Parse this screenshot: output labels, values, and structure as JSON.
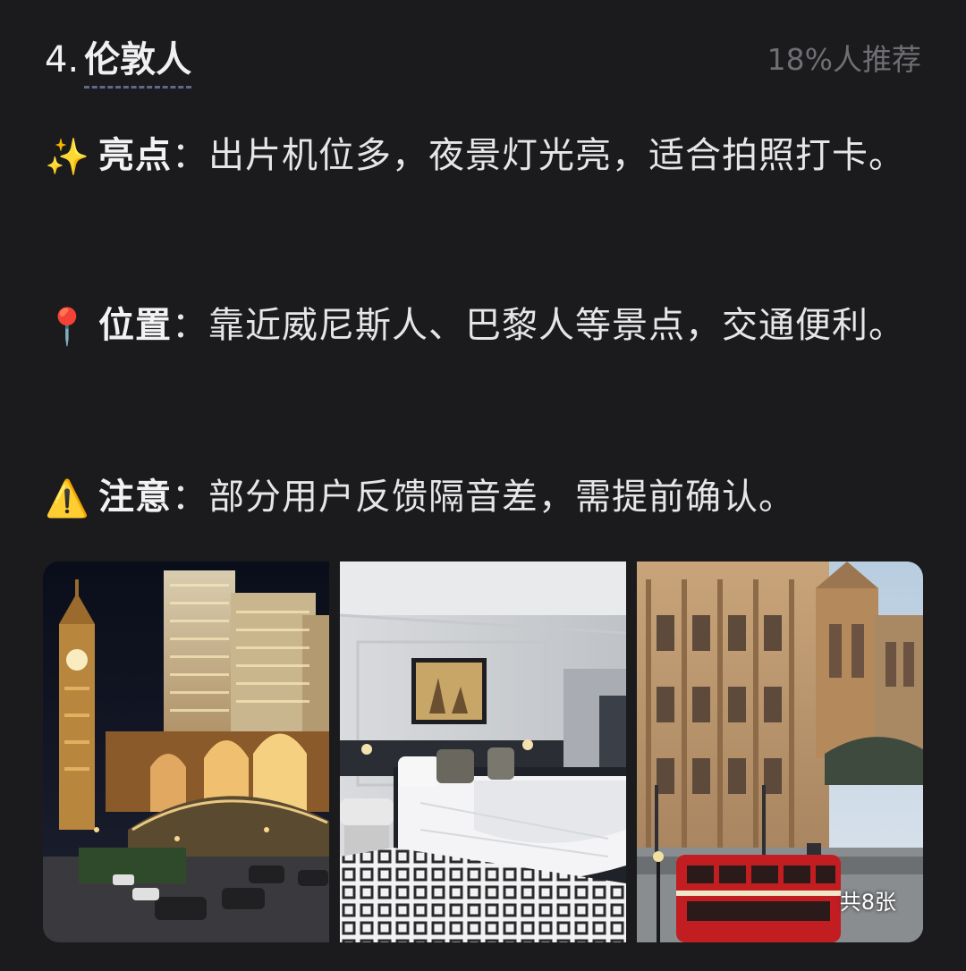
{
  "header": {
    "number": "4.",
    "name": "伦敦人",
    "recommend": "18%人推荐"
  },
  "items": [
    {
      "emoji": "✨",
      "label": "亮点",
      "sep": "：",
      "text": "出片机位多，夜景灯光亮，适合拍照打卡。"
    },
    {
      "emoji": "📍",
      "label": "位置",
      "sep": "：",
      "text": "靠近威尼斯人、巴黎人等景点，交通便利。"
    },
    {
      "emoji": "⚠️",
      "label": "注意",
      "sep": "：",
      "text": "部分用户反馈隔音差，需提前确认。"
    }
  ],
  "gallery": {
    "photos": [
      {
        "icon": "london-night-exterior-photo"
      },
      {
        "icon": "hotel-bedroom-photo"
      },
      {
        "icon": "gothic-facade-red-bus-photo"
      }
    ],
    "count_label": "共8张"
  }
}
